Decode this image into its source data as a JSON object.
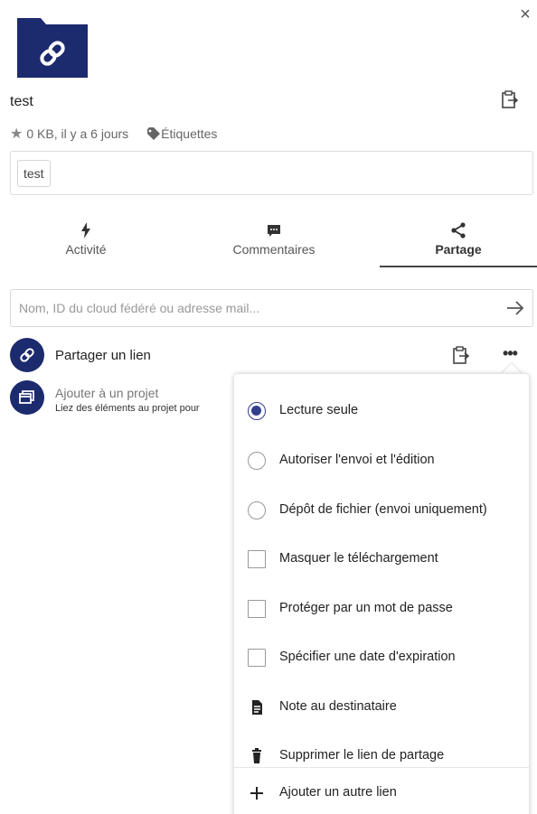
{
  "header": {
    "close_label": "×",
    "file_name": "test",
    "meta": "0 KB, il y a 6 jours",
    "tags_link": "Étiquettes",
    "tags": [
      "test"
    ]
  },
  "tabs": [
    {
      "label": "Activité",
      "icon": "bolt-icon",
      "active": false
    },
    {
      "label": "Commentaires",
      "icon": "comment-icon",
      "active": false
    },
    {
      "label": "Partage",
      "icon": "share-icon",
      "active": true
    }
  ],
  "share": {
    "search_placeholder": "Nom, ID du cloud fédéré ou adresse mail...",
    "share_link_label": "Partager un lien",
    "project_title": "Ajouter à un projet",
    "project_subtitle": "Liez des éléments au projet pour"
  },
  "menu": {
    "items": [
      {
        "label": "Lecture seule",
        "control": "radio",
        "checked": true
      },
      {
        "label": "Autoriser l'envoi et l'édition",
        "control": "radio",
        "checked": false
      },
      {
        "label": "Dépôt de fichier (envoi uniquement)",
        "control": "radio",
        "checked": false
      },
      {
        "label": "Masquer le téléchargement",
        "control": "checkbox",
        "checked": false
      },
      {
        "label": "Protéger par un mot de passe",
        "control": "checkbox",
        "checked": false
      },
      {
        "label": "Spécifier une date d'expiration",
        "control": "checkbox",
        "checked": false
      },
      {
        "label": "Note au destinataire",
        "control": "note-icon"
      },
      {
        "label": "Supprimer le lien de partage",
        "control": "trash-icon"
      },
      {
        "label": "Ajouter un autre lien",
        "control": "plus-icon"
      }
    ]
  },
  "colors": {
    "brand": "#1c2a6e",
    "radio_accent": "#333f8c"
  }
}
